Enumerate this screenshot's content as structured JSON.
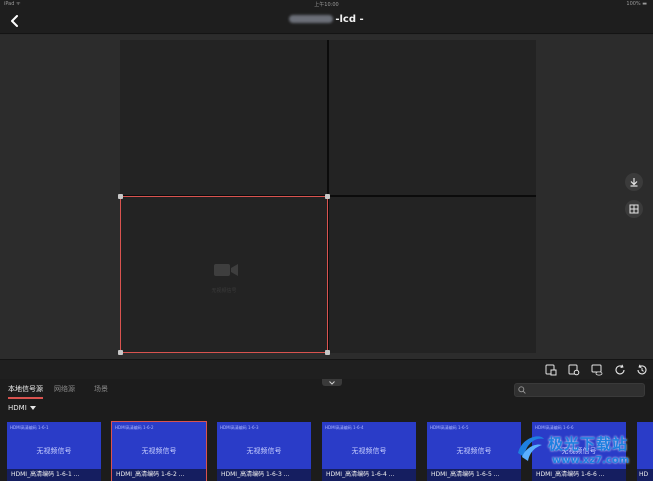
{
  "status_bar": {
    "left": "iPad ᯤ",
    "center": "上午10:00",
    "right": "100% ▬"
  },
  "nav": {
    "title_suffix": "-lcd -"
  },
  "screen_wall": {
    "window_caption": "无视频信号"
  },
  "tabs": [
    {
      "label": "本地信号源",
      "active": true
    },
    {
      "label": "网络源",
      "active": false
    },
    {
      "label": "场景",
      "active": false
    }
  ],
  "search": {
    "placeholder": ""
  },
  "filter": {
    "label": "HDMI"
  },
  "thumbnails": [
    {
      "top_text": "HDMI高清编码 1-6-1",
      "signal": "无视频信号",
      "label": "HDMI_高清编码 1-6-1 ..."
    },
    {
      "top_text": "HDMI高清编码 1-6-2",
      "signal": "无视频信号",
      "label": "HDMI_高清编码 1-6-2 ..."
    },
    {
      "top_text": "HDMI高清编码 1-6-3",
      "signal": "无视频信号",
      "label": "HDMI_高清编码 1-6-3 ..."
    },
    {
      "top_text": "HDMI高清编码 1-6-4",
      "signal": "无视频信号",
      "label": "HDMI_高清编码 1-6-4 ..."
    },
    {
      "top_text": "HDMI高清编码 1-6-5",
      "signal": "无视频信号",
      "label": "HDMI_高清编码 1-6-5 ..."
    },
    {
      "top_text": "HDMI高清编码 1-6-6",
      "signal": "无视频信号",
      "label": "HDMI_高清编码 1-6-6 ..."
    },
    {
      "top_text": "",
      "signal": "",
      "label": "HD"
    }
  ],
  "watermark": {
    "line1": "极光下载站",
    "line2": "www.xz7.com"
  },
  "colors": {
    "accent": "#d9534f",
    "thumb_blue": "#2a3cc8",
    "watermark_blue": "#1e7fe0"
  },
  "icons": {
    "back": "chevron-left-icon",
    "download": "download-icon",
    "layout": "grid-layout-icon",
    "camera": "video-camera-icon",
    "search": "search-icon"
  }
}
